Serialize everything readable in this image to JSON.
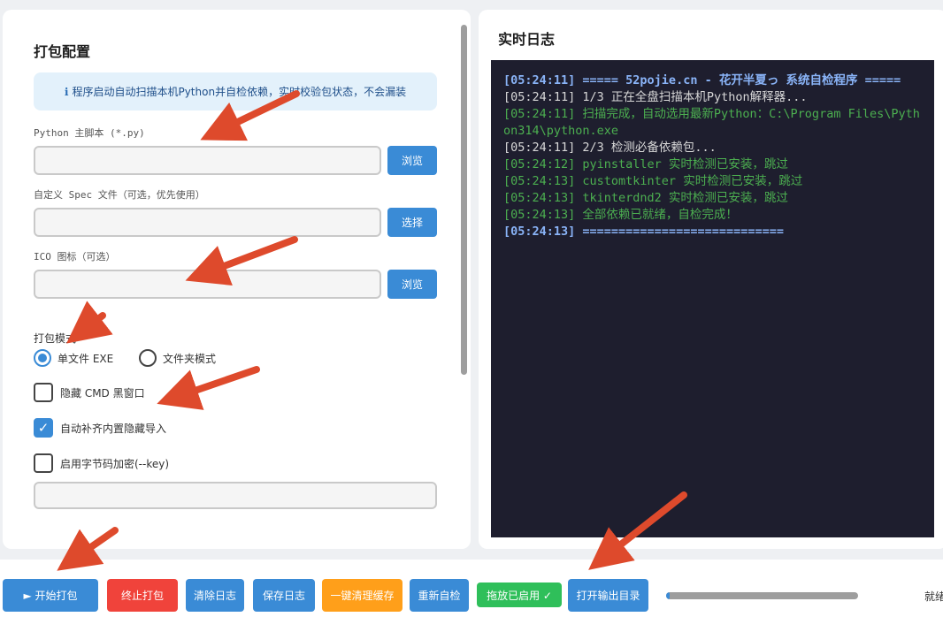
{
  "config_panel": {
    "title": "打包配置",
    "info": "程序启动自动扫描本机Python并自检依赖，实时校验包状态，不会漏装",
    "info_icon": "info-icon",
    "main_script": {
      "label": "Python 主脚本 (*.py)",
      "value": "",
      "button": "浏览"
    },
    "spec_file": {
      "label": "自定义 Spec 文件（可选，优先使用）",
      "value": "",
      "button": "选择"
    },
    "ico_file": {
      "label": "ICO 图标（可选）",
      "value": "",
      "button": "浏览"
    },
    "mode": {
      "label": "打包模式",
      "options": [
        {
          "label": "单文件 EXE",
          "selected": true
        },
        {
          "label": "文件夹模式",
          "selected": false
        }
      ]
    },
    "hide_cmd": {
      "label": "隐藏 CMD 黑窗口",
      "checked": false
    },
    "auto_imports": {
      "label": "自动补齐内置隐藏导入",
      "checked": true
    },
    "bytecode_key": {
      "label": "启用字节码加密(--key)",
      "checked": false,
      "value": ""
    }
  },
  "log_panel": {
    "title": "实时日志",
    "lines": [
      {
        "text": "[05:24:11] ===== 52pojie.cn - 花开半夏っ 系统自检程序 =====",
        "kind": "header"
      },
      {
        "text": "[05:24:11] 1/3 正在全盘扫描本机Python解释器...",
        "kind": "info"
      },
      {
        "text": "[05:24:11] 扫描完成，自动选用最新Python：C:\\Program Files\\Python314\\python.exe",
        "kind": "success"
      },
      {
        "text": "[05:24:11] 2/3 检测必备依赖包...",
        "kind": "info"
      },
      {
        "text": "[05:24:12] pyinstaller 实时检测已安装，跳过",
        "kind": "success"
      },
      {
        "text": "[05:24:13] customtkinter 实时检测已安装，跳过",
        "kind": "success"
      },
      {
        "text": "[05:24:13] tkinterdnd2 实时检测已安装，跳过",
        "kind": "success"
      },
      {
        "text": "[05:24:13] 全部依赖已就绪，自检完成！",
        "kind": "success"
      },
      {
        "text": "[05:24:13] ============================",
        "kind": "header"
      }
    ]
  },
  "toolbar": {
    "start": "► 开始打包",
    "stop": "终止打包",
    "clear_log": "清除日志",
    "save_log": "保存日志",
    "clean_cache": "一键清理缓存",
    "recheck": "重新自检",
    "drag_enabled": "拖放已启用 ✓",
    "open_output": "打开输出目录",
    "progress": 0.02,
    "status": "就绪"
  },
  "colors": {
    "primary": "#3a8bd6",
    "danger": "#f0433b",
    "warning": "#ff9f1a",
    "success": "#2fbf5a",
    "log_bg": "#1e1e2e",
    "annotation_arrow": "#de4a2c"
  }
}
